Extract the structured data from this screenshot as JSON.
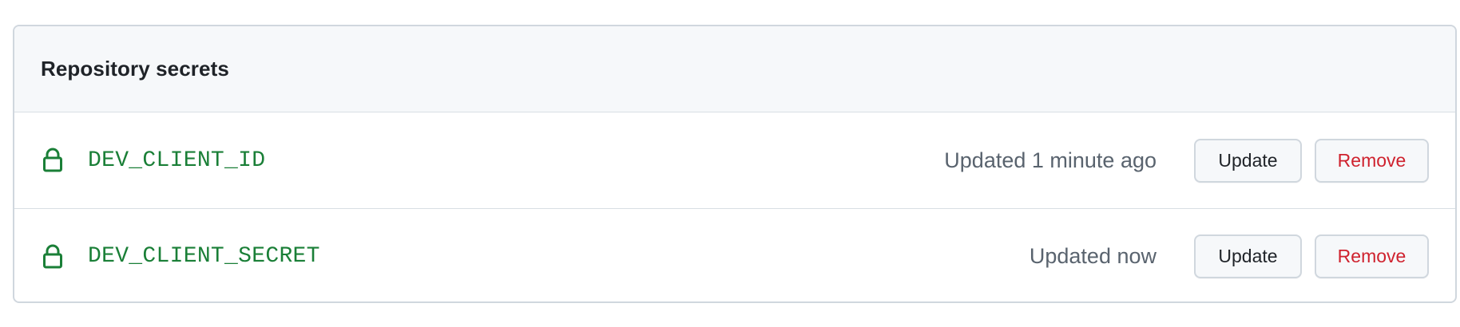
{
  "panel": {
    "title": "Repository secrets"
  },
  "secrets": [
    {
      "icon": "lock-icon",
      "name": "DEV_CLIENT_ID",
      "updated": "Updated 1 minute ago",
      "update_label": "Update",
      "remove_label": "Remove"
    },
    {
      "icon": "lock-icon",
      "name": "DEV_CLIENT_SECRET",
      "updated": "Updated now",
      "update_label": "Update",
      "remove_label": "Remove"
    }
  ],
  "colors": {
    "secret_name": "#1a7f37",
    "remove_text": "#cf222e",
    "header_bg": "#f6f8fa",
    "border": "#d0d7de"
  }
}
